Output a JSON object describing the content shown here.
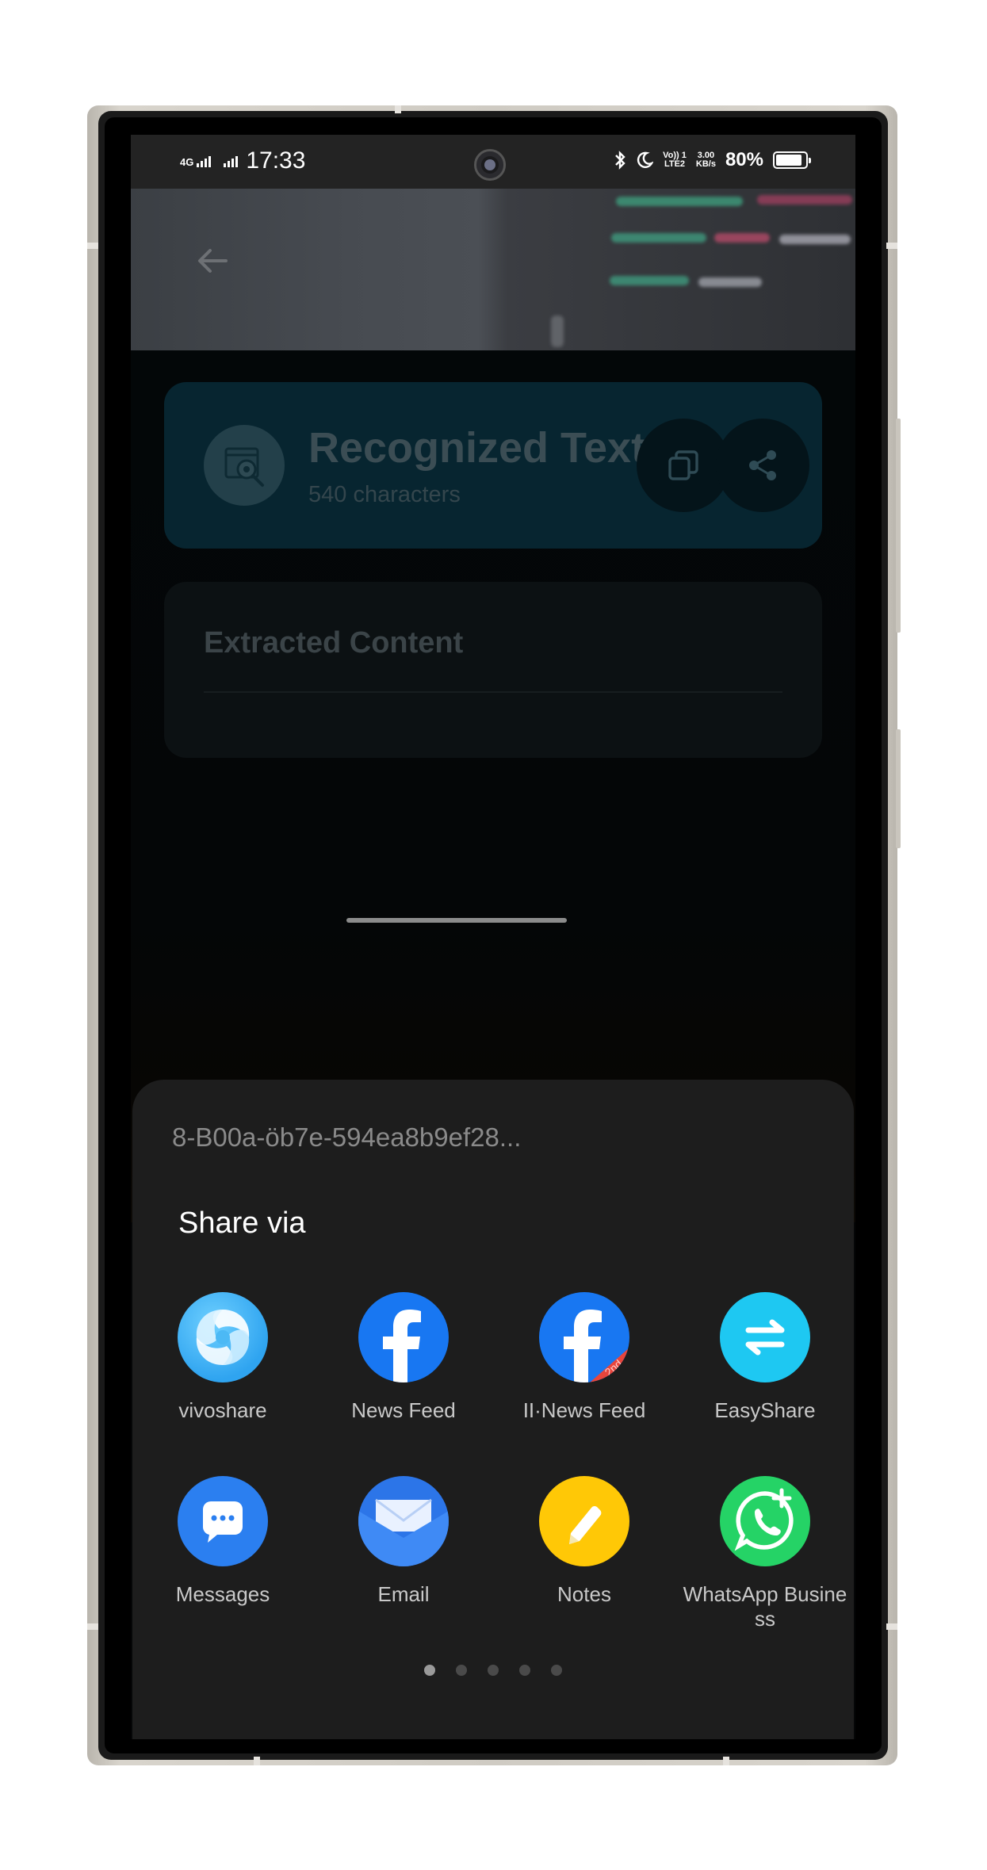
{
  "status_bar": {
    "network": "4G",
    "time": "17:33",
    "volte": "Vo)) 1\nLTE2",
    "speed": "3.00\nKB/s",
    "battery": "80%"
  },
  "recognized": {
    "title": "Recognized Text",
    "subtitle": "540 characters"
  },
  "extracted": {
    "title": "Extracted Content"
  },
  "share": {
    "file_name": "8-B00a-öb7e-594ea8b9ef28...",
    "title": "Share via",
    "apps": [
      {
        "label": "vivoshare",
        "icon": "vivoshare-icon",
        "color": "#2fa4f0"
      },
      {
        "label": "News Feed",
        "icon": "facebook-icon",
        "color": "#1877f2"
      },
      {
        "label": "II·News Feed",
        "icon": "facebook-clone-icon",
        "color": "#1877f2"
      },
      {
        "label": "EasyShare",
        "icon": "easyshare-icon",
        "color": "#1ec8f2"
      },
      {
        "label": "Messages",
        "icon": "messages-icon",
        "color": "#2b7ff0"
      },
      {
        "label": "Email",
        "icon": "email-icon",
        "color": "#2c75e8"
      },
      {
        "label": "Notes",
        "icon": "notes-icon",
        "color": "#ffc806"
      },
      {
        "label": "WhatsApp Busine\nss",
        "icon": "whatsapp-business-icon",
        "color": "#25d366"
      }
    ],
    "page_count": 5,
    "current_page": 1
  }
}
